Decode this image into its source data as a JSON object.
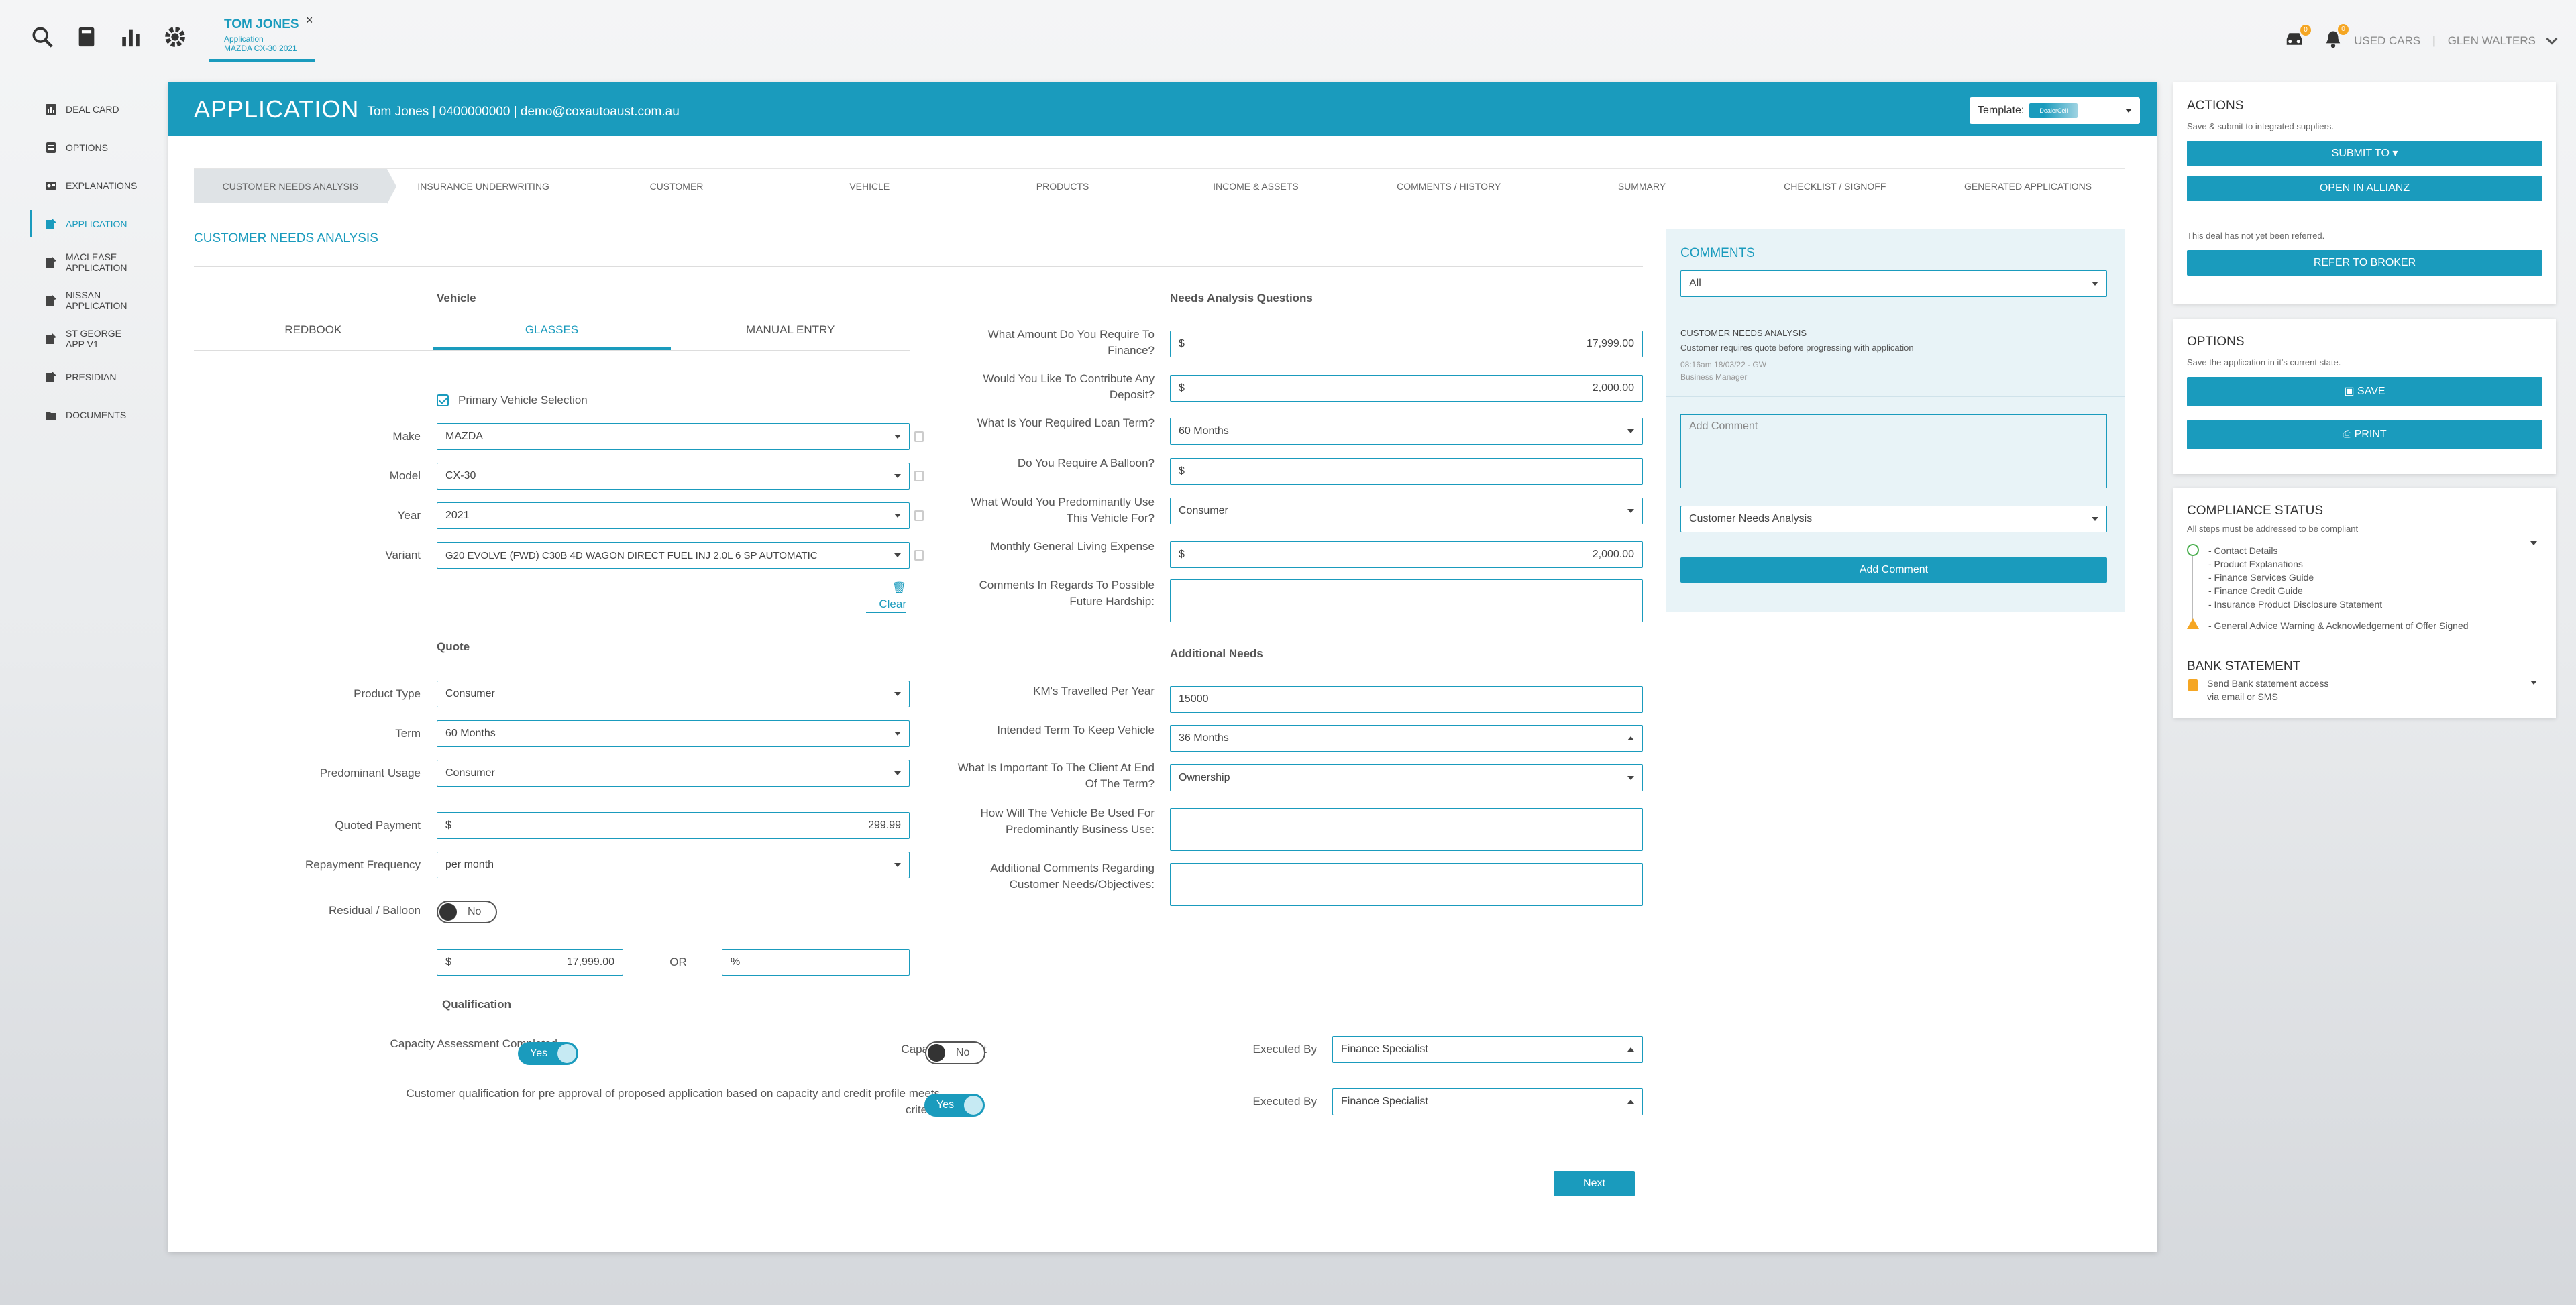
{
  "topbar": {
    "user_tab": {
      "name": "TOM JONES",
      "line1": "Application",
      "line2": "MAZDA CX-30 2021",
      "close": "×"
    },
    "right": {
      "dealership": "USED CARS",
      "separator": "|",
      "user": "GLEN WALTERS",
      "notif_count_1": "0",
      "notif_count_2": "0"
    }
  },
  "sidebar": {
    "items": [
      {
        "label": "DEAL CARD"
      },
      {
        "label": "OPTIONS"
      },
      {
        "label": "EXPLANATIONS"
      },
      {
        "label": "APPLICATION"
      },
      {
        "label": "MACLEASE\nAPPLICATION"
      },
      {
        "label": "NISSAN\nAPPLICATION"
      },
      {
        "label": "ST GEORGE\nAPP V1"
      },
      {
        "label": "PRESIDIAN"
      },
      {
        "label": "DOCUMENTS"
      }
    ]
  },
  "main": {
    "title": "APPLICATION",
    "info": "Tom Jones | 0400000000 | demo@coxautoaust.com.au",
    "template_label": "Template:",
    "template_logo": "DealerCell",
    "steps": [
      "CUSTOMER NEEDS ANALYSIS",
      "INSURANCE UNDERWRITING",
      "CUSTOMER",
      "VEHICLE",
      "PRODUCTS",
      "INCOME & ASSETS",
      "COMMENTS / HISTORY",
      "SUMMARY",
      "CHECKLIST / SIGNOFF",
      "GENERATED APPLICATIONS"
    ],
    "section_title": "CUSTOMER NEEDS ANALYSIS",
    "vehicle": {
      "heading": "Vehicle",
      "tabs": [
        "REDBOOK",
        "GLASSES",
        "MANUAL ENTRY"
      ],
      "primary_label": "Primary Vehicle Selection",
      "make_label": "Make",
      "make": "MAZDA",
      "model_label": "Model",
      "model": "CX-30",
      "year_label": "Year",
      "year": "2021",
      "variant_label": "Variant",
      "variant": "G20 EVOLVE (FWD) C30B 4D WAGON DIRECT FUEL INJ 2.0L 6 SP AUTOMATIC",
      "clear": "Clear"
    },
    "quote": {
      "heading": "Quote",
      "product_type_label": "Product Type",
      "product_type": "Consumer",
      "term_label": "Term",
      "term": "60 Months",
      "usage_label": "Predominant Usage",
      "usage": "Consumer",
      "payment_label": "Quoted Payment",
      "payment_prefix": "$",
      "payment": "299.99",
      "frequency_label": "Repayment Frequency",
      "frequency": "per month",
      "residual_label": "Residual / Balloon",
      "residual_toggle": "No",
      "residual_prefix": "$",
      "residual_amount": "17,999.00",
      "or": "OR",
      "pct": "%"
    },
    "needs": {
      "heading": "Needs Analysis Questions",
      "q1": "What Amount Do You Require To\nFinance?",
      "a1_prefix": "$",
      "a1": "17,999.00",
      "q2": "Would You Like To Contribute Any\nDeposit?",
      "a2_prefix": "$",
      "a2": "2,000.00",
      "q3": "What Is Your Required Loan Term?",
      "a3": "60 Months",
      "q4": "Do You Require A Balloon?",
      "a4_prefix": "$",
      "q5": "What Would You Predominantly Use\nThis Vehicle For?",
      "a5": "Consumer",
      "q6": "Monthly General Living Expense",
      "a6_prefix": "$",
      "a6": "2,000.00",
      "q7": "Comments In Regards To Possible\nFuture Hardship:"
    },
    "additional": {
      "heading": "Additional Needs",
      "q1": "KM's Travelled Per Year",
      "a1": "15000",
      "q2": "Intended Term To Keep Vehicle",
      "a2": "36 Months",
      "q3": "What Is Important To The Client At End\nOf The Term?",
      "a3": "Ownership",
      "q4": "How Will The Vehicle Be Used For\nPredominantly Business Use:",
      "q5": "Additional Comments Regarding\nCustomer Needs/Objectives:"
    },
    "qualification": {
      "heading": "Qualification",
      "cap_assess_label": "Capacity Assessment Completed",
      "cap_assess": "Yes",
      "cap_evident_label": "Capacity Evident",
      "cap_evident": "No",
      "executed_by_label": "Executed By",
      "executed_by_1": "Finance Specialist",
      "preapproval_label": "Customer qualification for pre approval of proposed application based on capacity and credit profile meets\ncriteria",
      "preapproval": "Yes",
      "executed_by_2": "Finance Specialist"
    },
    "next": "Next"
  },
  "comments": {
    "title": "COMMENTS",
    "filter": "All",
    "entry_title": "CUSTOMER NEEDS ANALYSIS",
    "entry_text": "Customer requires quote before progressing with application",
    "entry_meta": "08:16am 18/03/22 - GW",
    "entry_role": "Business Manager",
    "add_placeholder": "Add Comment",
    "category": "Customer Needs Analysis",
    "add_button": "Add Comment"
  },
  "actions": {
    "title": "ACTIONS",
    "desc": "Save & submit to integrated suppliers.",
    "submit": "SUBMIT TO ▾",
    "allianz": "OPEN IN ALLIANZ",
    "not_referred": "This deal has not yet been referred.",
    "broker": "REFER TO BROKER"
  },
  "options": {
    "title": "OPTIONS",
    "desc": "Save the application in it's current state.",
    "save": "SAVE",
    "print": "PRINT"
  },
  "compliance": {
    "title": "COMPLIANCE STATUS",
    "desc": "All steps must be addressed to be compliant",
    "items": [
      "- Contact Details",
      "- Product Explanations",
      "- Finance Services Guide",
      "- Finance Credit Guide",
      "- Insurance Product Disclosure Statement"
    ],
    "warning": "- General Advice Warning & Acknowledgement of Offer Signed",
    "bank_title": "BANK STATEMENT",
    "bank_desc_1": "Send Bank statement access",
    "bank_desc_2": "via email or SMS"
  }
}
